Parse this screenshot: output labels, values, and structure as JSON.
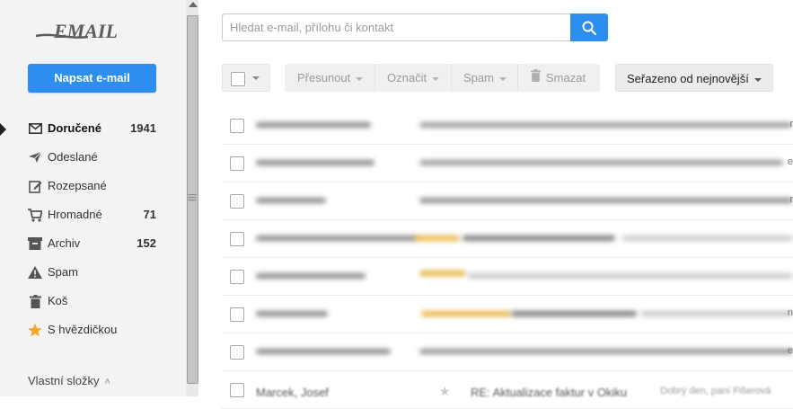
{
  "app": {
    "logo_text": "EMAIL",
    "compose_label": "Napsat e-mail",
    "accent": "#2b8ef0"
  },
  "folders": [
    {
      "label": "Doručené",
      "count": "1941",
      "icon": "envelope-icon",
      "active": true
    },
    {
      "label": "Odeslané",
      "count": "",
      "icon": "send-icon"
    },
    {
      "label": "Rozepsané",
      "count": "",
      "icon": "draft-icon"
    },
    {
      "label": "Hromadné",
      "count": "71",
      "icon": "cart-icon"
    },
    {
      "label": "Archiv",
      "count": "152",
      "icon": "archive-icon"
    },
    {
      "label": "Spam",
      "count": "",
      "icon": "warning-icon"
    },
    {
      "label": "Koš",
      "count": "",
      "icon": "trash-icon"
    },
    {
      "label": "S hvězdičkou",
      "count": "",
      "icon": "star-icon"
    }
  ],
  "custom_folders_label": "Vlastní složky",
  "search": {
    "placeholder": "Hledat e-mail, přílohu či kontakt"
  },
  "toolbar": {
    "move_label": "Přesunout",
    "mark_label": "Označit",
    "spam_label": "Spam",
    "delete_label": "Smazat",
    "sort_label": "Seřazeno od nejnovější"
  },
  "messages": {
    "last": {
      "sender": "Marcek, Josef",
      "subject": "RE: Aktualizace faktur v Okiku",
      "preview": "Dobrý den, paní Fišerová"
    }
  }
}
